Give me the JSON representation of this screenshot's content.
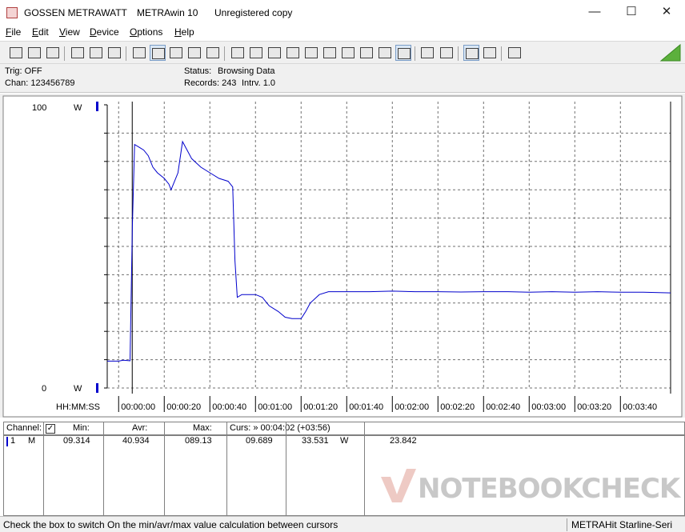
{
  "window": {
    "brand": "GOSSEN METRAWATT",
    "app_name": "METRAwin 10",
    "license": "Unregistered copy",
    "minimize": "—",
    "maximize": "☐",
    "close": "✕"
  },
  "menu": [
    {
      "label": "File",
      "key": "F",
      "rest": "ile"
    },
    {
      "label": "Edit",
      "key": "E",
      "rest": "dit"
    },
    {
      "label": "View",
      "key": "V",
      "rest": "iew"
    },
    {
      "label": "Device",
      "key": "D",
      "rest": "evice"
    },
    {
      "label": "Options",
      "key": "O",
      "rest": "ptions"
    },
    {
      "label": "Help",
      "key": "H",
      "rest": "elp"
    }
  ],
  "info": {
    "trig": "Trig: OFF",
    "chan": "Chan:  123456789",
    "status_label": "Status:",
    "status_value": "Browsing Data",
    "records_label": "Records: 243",
    "interval": "Intrv. 1.0"
  },
  "chart_data": {
    "type": "line",
    "ylim": [
      0,
      100
    ],
    "y_max_label": "100",
    "y_min_label": "0",
    "y_unit": "W",
    "x_axis_label": "HH:MM:SS",
    "x_ticks": [
      "00:00:00",
      "00:00:20",
      "00:00:40",
      "00:01:00",
      "00:01:20",
      "00:01:40",
      "00:02:00",
      "00:02:20",
      "00:02:40",
      "00:03:00",
      "00:03:20",
      "00:03:40"
    ],
    "xlim_seconds": [
      -5,
      242
    ],
    "grid": true,
    "line_color": "#0000cc",
    "cursor_seconds": 0,
    "series": [
      {
        "x": [
          -5,
          -2,
          0,
          2,
          5,
          6,
          7,
          9,
          11,
          13,
          15,
          17,
          20,
          22,
          23,
          24,
          26,
          28,
          30,
          32,
          36,
          40,
          44,
          48,
          50,
          51,
          52,
          54,
          60,
          63,
          66,
          70,
          73,
          76,
          80,
          82,
          84,
          88,
          92,
          100,
          110,
          120,
          130,
          140,
          150,
          160,
          170,
          180,
          190,
          200,
          210,
          220,
          230,
          242
        ],
        "y": [
          9.5,
          9.5,
          9.5,
          9.8,
          9.6,
          57,
          86,
          85,
          84,
          82,
          78,
          76,
          74,
          72,
          70,
          72,
          76,
          87,
          84,
          81,
          78,
          76,
          74,
          73,
          71,
          45,
          32,
          33,
          33,
          32,
          29,
          27,
          25,
          24.5,
          24.5,
          27,
          30,
          33,
          34,
          34,
          34,
          34.2,
          34,
          34,
          33.9,
          34,
          34,
          33.8,
          34,
          33.8,
          34,
          33.8,
          33.8,
          33.6
        ]
      }
    ]
  },
  "table": {
    "headers": {
      "channel": "Channel:",
      "min": "Min:",
      "avr": "Avr:",
      "max": "Max:",
      "cursor": "Curs: » 00:04:02 (+03:56)"
    },
    "row": {
      "num": "1",
      "mode": "M",
      "min": "09.314",
      "avr": "40.934",
      "max": "089.13",
      "curs1": "09.689",
      "curs2": "33.531",
      "unit": "W",
      "curs3": "23.842"
    },
    "checkbox_checked": true
  },
  "status": {
    "hint": "Check the box to switch On the min/avr/max value calculation between cursors",
    "device": "METRAHit Starline-Seri"
  },
  "watermark": "NOTEBOOKCHECK"
}
